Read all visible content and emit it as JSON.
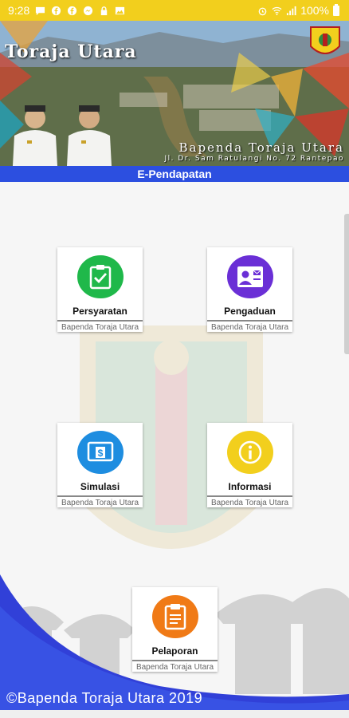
{
  "status_bar": {
    "time": "9:28",
    "battery": "100%",
    "notification_icons": [
      "message-icon",
      "facebook-icon",
      "facebook-icon",
      "messenger-icon",
      "lock-icon",
      "image-icon"
    ]
  },
  "banner": {
    "title": "Toraja Utara",
    "organization": "Bapenda Toraja Utara",
    "address": "Jl. Dr. Sam Ratulangi No. 72 Rantepao"
  },
  "app_bar": {
    "title": "E-Pendapatan"
  },
  "menu": [
    {
      "label": "Persyaratan",
      "subtitle": "Bapenda Toraja Utara",
      "icon": "clipboard-check-icon",
      "color": "#1fb84a"
    },
    {
      "label": "Pengaduan",
      "subtitle": "Bapenda Toraja Utara",
      "icon": "contact-card-icon",
      "color": "#6a2fd6"
    },
    {
      "label": "Simulasi",
      "subtitle": "Bapenda Toraja Utara",
      "icon": "money-icon",
      "color": "#1e8de0"
    },
    {
      "label": "Informasi",
      "subtitle": "Bapenda Toraja Utara",
      "icon": "info-icon",
      "color": "#f2cf1d"
    },
    {
      "label": "Pelaporan",
      "subtitle": "Bapenda Toraja Utara",
      "icon": "clipboard-icon",
      "color": "#f07a16"
    }
  ],
  "footer": {
    "copyright": "©Bapenda Toraja Utara 2019"
  },
  "colors": {
    "status_bar": "#f2cf1d",
    "app_bar": "#2c4fe0",
    "wave": "#3140d8"
  }
}
